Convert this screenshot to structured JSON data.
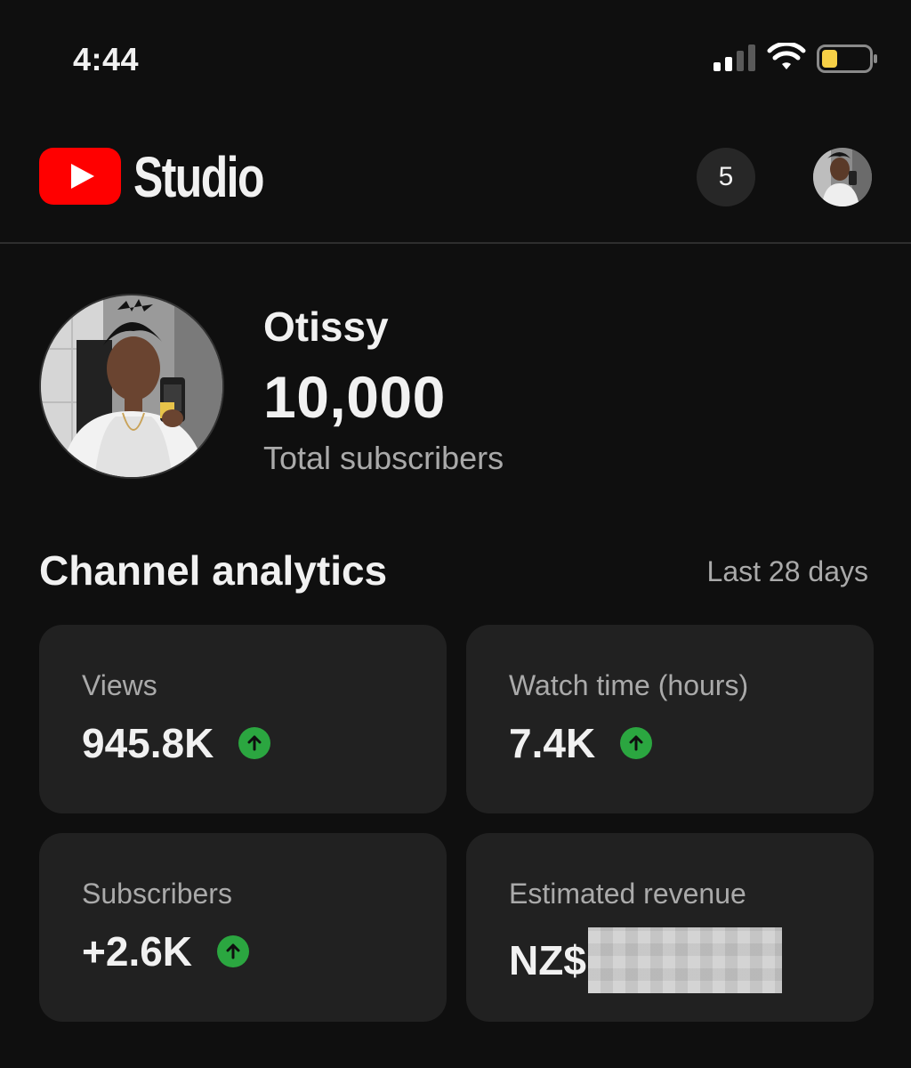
{
  "status_bar": {
    "time": "4:44"
  },
  "header": {
    "app_title": "Studio",
    "notifications_count": "5"
  },
  "channel": {
    "name": "Otissy",
    "subscriber_count": "10,000",
    "subscriber_label": "Total subscribers"
  },
  "analytics": {
    "title": "Channel analytics",
    "period": "Last 28 days",
    "cards": [
      {
        "label": "Views",
        "value": "945.8K",
        "trend": "up"
      },
      {
        "label": "Watch time (hours)",
        "value": "7.4K",
        "trend": "up"
      },
      {
        "label": "Subscribers",
        "value": "+2.6K",
        "trend": "up"
      },
      {
        "label": "Estimated revenue",
        "value": "NZ$",
        "redacted": true
      }
    ]
  },
  "colors": {
    "background": "#0f0f0f",
    "card": "#212121",
    "brand_red": "#ff0000",
    "trend_green": "#2ba640",
    "battery_yellow": "#f7d046"
  },
  "icons": [
    "cellular-signal-icon",
    "wifi-icon",
    "battery-icon",
    "youtube-play-icon",
    "trend-up-icon"
  ]
}
